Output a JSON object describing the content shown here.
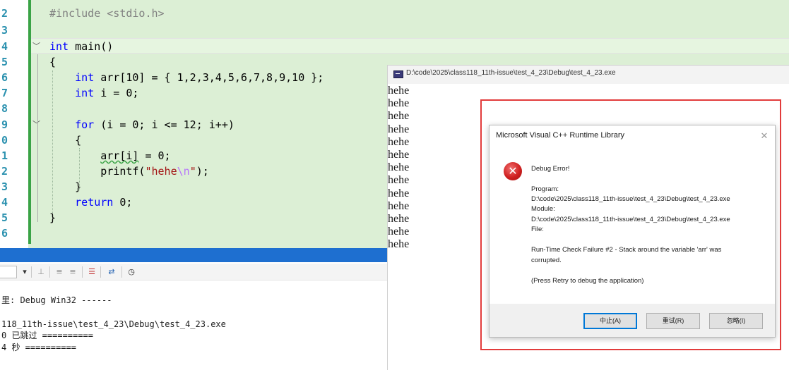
{
  "editor": {
    "line_numbers": [
      "2",
      "3",
      "4",
      "5",
      "6",
      "7",
      "8",
      "9",
      "0",
      "1",
      "2",
      "3",
      "4",
      "5",
      "6"
    ],
    "lines": [
      {
        "parts": [
          [
            "pp",
            "#include <stdio.h>"
          ]
        ]
      },
      {
        "parts": []
      },
      {
        "parts": [
          [
            "kw",
            "int"
          ],
          [
            "",
            " main()"
          ]
        ]
      },
      {
        "parts": [
          [
            "",
            "{"
          ]
        ]
      },
      {
        "parts": [
          [
            "",
            "    "
          ],
          [
            "kw",
            "int"
          ],
          [
            "",
            " arr[10] = { 1,2,3,4,5,6,7,8,9,10 };"
          ]
        ]
      },
      {
        "parts": [
          [
            "",
            "    "
          ],
          [
            "kw",
            "int"
          ],
          [
            "",
            " i = 0;"
          ]
        ]
      },
      {
        "parts": []
      },
      {
        "parts": [
          [
            "",
            "    "
          ],
          [
            "kw",
            "for"
          ],
          [
            "",
            " (i = 0; i <= 12; i++)"
          ]
        ]
      },
      {
        "parts": [
          [
            "",
            "    {"
          ]
        ]
      },
      {
        "parts": [
          [
            "",
            "        "
          ],
          [
            "squiggle",
            "arr[i]"
          ],
          [
            "",
            " = 0;"
          ]
        ]
      },
      {
        "parts": [
          [
            "",
            "        printf("
          ],
          [
            "str",
            "\"hehe"
          ],
          [
            "esc",
            "\\n"
          ],
          [
            "str",
            "\""
          ],
          [
            "",
            ");"
          ]
        ]
      },
      {
        "parts": [
          [
            "",
            "    }"
          ]
        ]
      },
      {
        "parts": [
          [
            "",
            "    "
          ],
          [
            "kw",
            "return"
          ],
          [
            "",
            " 0;"
          ]
        ]
      },
      {
        "parts": [
          [
            "",
            "}"
          ]
        ]
      },
      {
        "parts": []
      }
    ]
  },
  "output": {
    "lines": [
      "里: Debug Win32 ------",
      "",
      "118_11th-issue\\test_4_23\\Debug\\test_4_23.exe",
      "0 已跳过 ==========",
      "4 秒 =========="
    ]
  },
  "console": {
    "title": "D:\\code\\2025\\class118_11th-issue\\test_4_23\\Debug\\test_4_23.exe",
    "lines": [
      "hehe",
      "hehe",
      "hehe",
      "hehe",
      "hehe",
      "hehe",
      "hehe",
      "hehe",
      "hehe",
      "hehe",
      "hehe",
      "hehe",
      "hehe"
    ]
  },
  "dialog": {
    "title": "Microsoft Visual C++ Runtime Library",
    "close_glyph": "✕",
    "icon_glyph": "✕",
    "heading": "Debug Error!",
    "program_label": "Program:",
    "program_path": "D:\\code\\2025\\class118_11th-issue\\test_4_23\\Debug\\test_4_23.exe",
    "module_label": "Module:",
    "module_path": "D:\\code\\2025\\class118_11th-issue\\test_4_23\\Debug\\test_4_23.exe",
    "file_label": "File:",
    "message_line1": "Run-Time Check Failure #2 - Stack around the variable 'arr' was",
    "message_line2": "corrupted.",
    "hint": "(Press Retry to debug the application)",
    "buttons": {
      "abort": "中止(A)",
      "retry": "重试(R)",
      "ignore": "忽略(I)"
    }
  }
}
